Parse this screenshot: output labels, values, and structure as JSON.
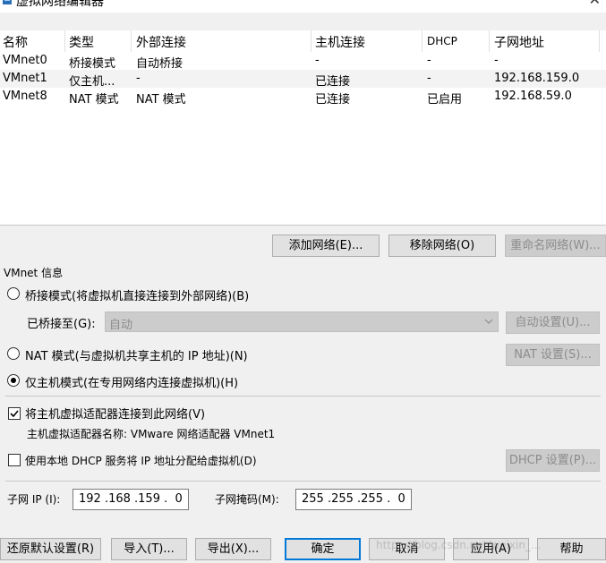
{
  "window": {
    "title": "虚拟网络编辑器"
  },
  "table": {
    "headers": {
      "name": "名称",
      "type": "类型",
      "external": "外部连接",
      "host": "主机连接",
      "dhcp": "DHCP",
      "subnet": "子网地址"
    },
    "rows": [
      {
        "name": "VMnet0",
        "type": "桥接模式",
        "external": "自动桥接",
        "host": "-",
        "dhcp": "-",
        "subnet": "-"
      },
      {
        "name": "VMnet1",
        "type": "仅主机...",
        "external": "-",
        "host": "已连接",
        "dhcp": "-",
        "subnet": "192.168.159.0"
      },
      {
        "name": "VMnet8",
        "type": "NAT 模式",
        "external": "NAT 模式",
        "host": "已连接",
        "dhcp": "已启用",
        "subnet": "192.168.59.0"
      }
    ]
  },
  "list_buttons": {
    "add": "添加网络(E)...",
    "remove": "移除网络(O)",
    "rename": "重命名网络(W)..."
  },
  "vmnet_info": {
    "group_label": "VMnet 信息",
    "bridge_radio": "桥接模式(将虚拟机直接连接到外部网络)(B)",
    "bridged_to_label": "已桥接至(G):",
    "bridged_to_value": "自动",
    "auto_settings": "自动设置(U)...",
    "nat_radio": "NAT 模式(与虚拟机共享主机的 IP 地址)(N)",
    "nat_settings": "NAT 设置(S)...",
    "hostonly_radio": "仅主机模式(在专用网络内连接虚拟机)(H)",
    "connect_adapter_checkbox": "将主机虚拟适配器连接到此网络(V)",
    "adapter_name_label": "主机虚拟适配器名称: VMware 网络适配器 VMnet1",
    "dhcp_checkbox": "使用本地 DHCP 服务将 IP 地址分配给虚拟机(D)",
    "dhcp_settings": "DHCP 设置(P)...",
    "subnet_ip_label": "子网 IP (I):",
    "subnet_ip_value": "192 .168 .159 .  0",
    "subnet_mask_label": "子网掩码(M):",
    "subnet_mask_value": "255 .255 .255 .  0"
  },
  "state": {
    "selected_row": "VMnet1",
    "mode": "host-only",
    "connect_adapter_checked": true,
    "dhcp_checked": false
  },
  "footer": {
    "restore": "还原默认设置(R)",
    "import": "导入(T)...",
    "export": "导出(X)...",
    "ok": "确定",
    "cancel": "取消",
    "apply": "应用(A)",
    "help": "帮助"
  },
  "watermark": "https://blog.csdn.net/weixin_...",
  "colors": {
    "window_bg": "#f0f0f0",
    "list_bg": "#ffffff",
    "default_button_border": "#0078d7",
    "disabled_text": "#8c8c8c"
  }
}
